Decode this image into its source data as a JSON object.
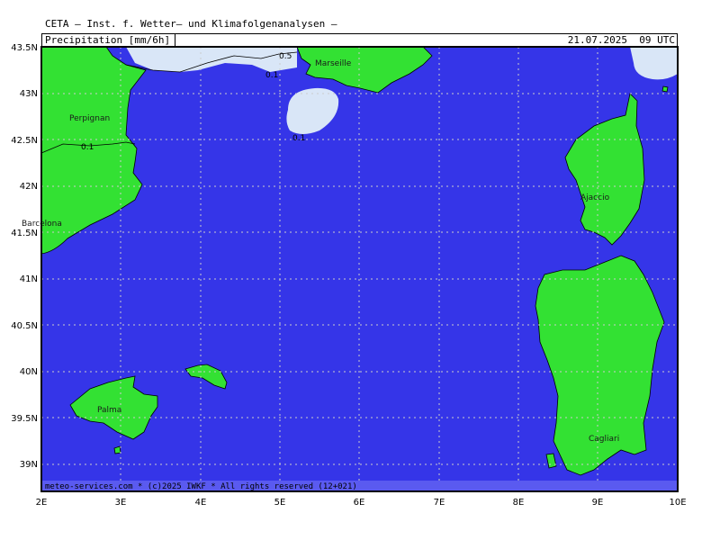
{
  "header": {
    "title": "CETA – Inst. f. Wetter– und Klimafolgenanalysen –",
    "parameter": "Precipitation [mm/6h]",
    "valid_time": "21.07.2025  09 UTC"
  },
  "footer": "meteo-services.com * (c)2025 IWKF * All rights reserved (12+021)",
  "colors": {
    "sea": "#3535e8",
    "land": "#33e133",
    "precip_light": "#d9e6f7",
    "grid": "#c8c8c8",
    "border": "#000000"
  },
  "axes": {
    "lon_labels": [
      "2E",
      "3E",
      "4E",
      "5E",
      "6E",
      "7E",
      "8E",
      "9E",
      "10E"
    ],
    "lat_labels": [
      "43.5N",
      "43N",
      "42.5N",
      "42N",
      "41.5N",
      "41N",
      "40.5N",
      "40N",
      "39.5N",
      "39N"
    ]
  },
  "cities": [
    {
      "name": "Marseille"
    },
    {
      "name": "Perpignan"
    },
    {
      "name": "Barcelona"
    },
    {
      "name": "Ajaccio"
    },
    {
      "name": "Palma"
    },
    {
      "name": "Cagliari"
    }
  ],
  "isolines": [
    {
      "label": "0.5"
    },
    {
      "label": "0.1"
    },
    {
      "label": "0.1"
    },
    {
      "label": "0.1"
    }
  ]
}
